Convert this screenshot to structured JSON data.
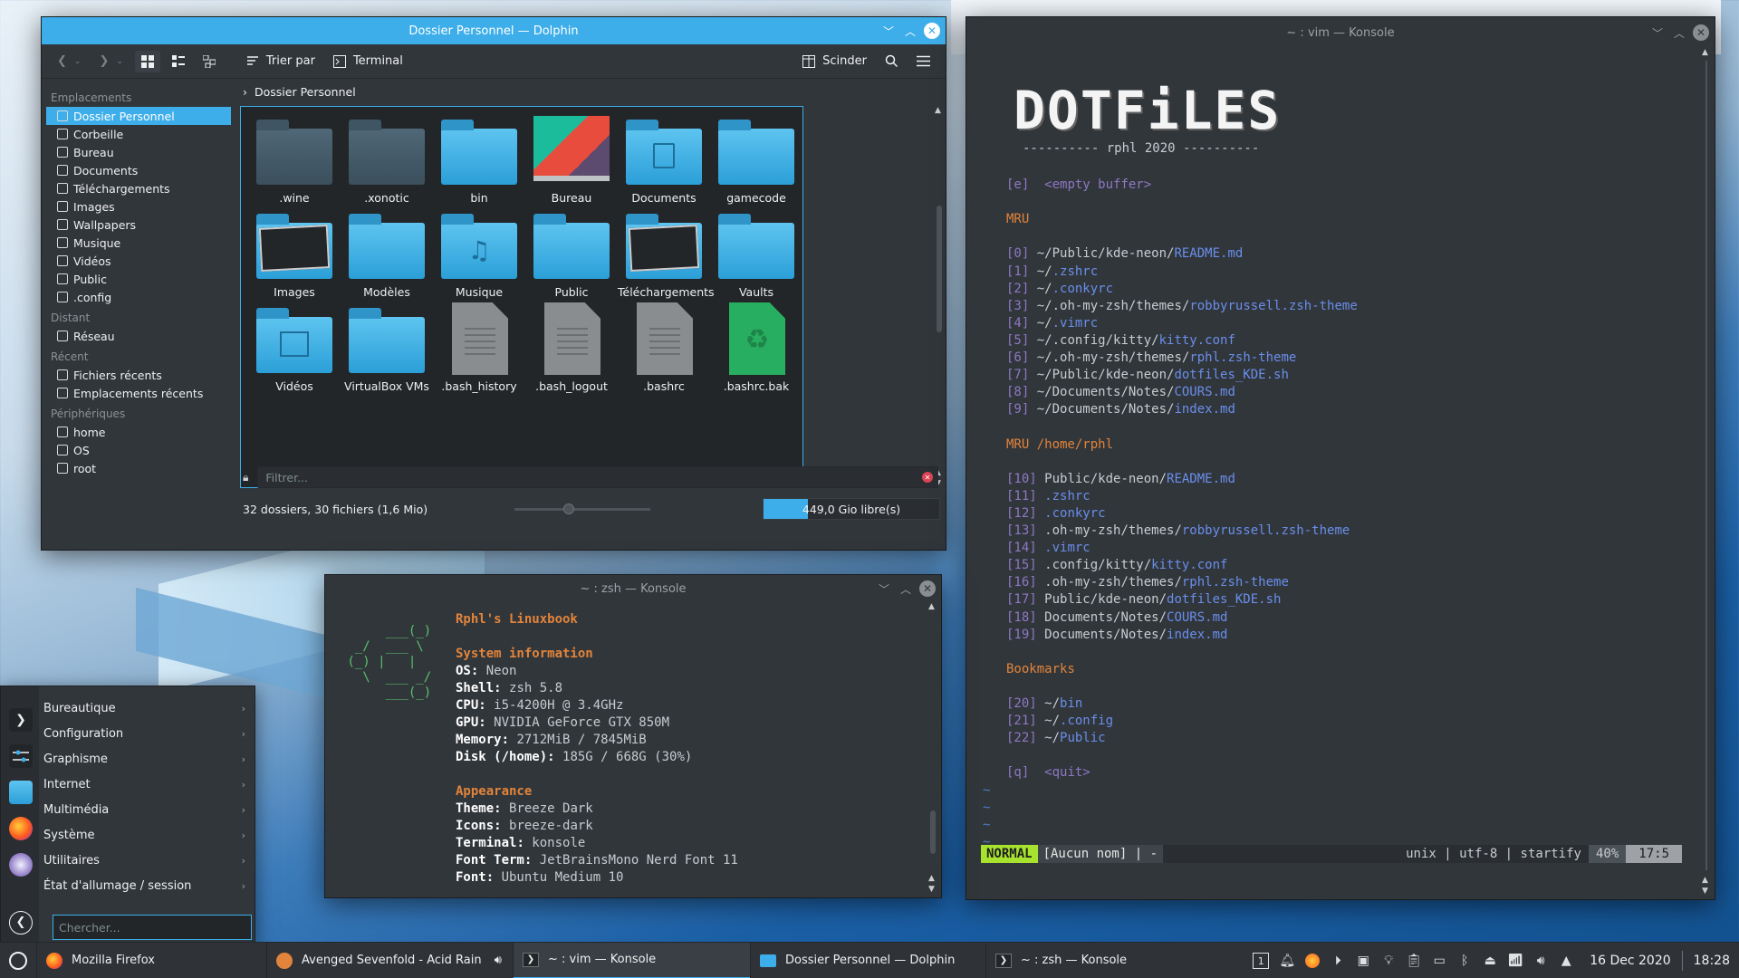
{
  "dolphin": {
    "title": "Dossier Personnel — Dolphin",
    "toolbar": {
      "sort": "Trier par",
      "terminal": "Terminal",
      "split": "Scinder"
    },
    "sidebar": [
      {
        "type": "head",
        "label": "Emplacements"
      },
      {
        "type": "item",
        "label": "Dossier Personnel",
        "selected": true,
        "icon": "home-icon"
      },
      {
        "type": "item",
        "label": "Corbeille",
        "icon": "trash-icon"
      },
      {
        "type": "item",
        "label": "Bureau",
        "icon": "desktop-icon"
      },
      {
        "type": "item",
        "label": "Documents",
        "icon": "documents-icon"
      },
      {
        "type": "item",
        "label": "Téléchargements",
        "icon": "downloads-icon"
      },
      {
        "type": "item",
        "label": "Images",
        "icon": "images-icon"
      },
      {
        "type": "item",
        "label": "Wallpapers",
        "icon": "folder-icon"
      },
      {
        "type": "item",
        "label": "Musique",
        "icon": "music-icon"
      },
      {
        "type": "item",
        "label": "Vidéos",
        "icon": "videos-icon"
      },
      {
        "type": "item",
        "label": "Public",
        "icon": "folder-icon"
      },
      {
        "type": "item",
        "label": ".config",
        "icon": "folder-icon"
      },
      {
        "type": "head",
        "label": "Distant"
      },
      {
        "type": "item",
        "label": "Réseau",
        "icon": "network-icon"
      },
      {
        "type": "head",
        "label": "Récent"
      },
      {
        "type": "item",
        "label": "Fichiers récents",
        "icon": "recent-files-icon"
      },
      {
        "type": "item",
        "label": "Emplacements récents",
        "icon": "recent-places-icon"
      },
      {
        "type": "head",
        "label": "Périphériques"
      },
      {
        "type": "item",
        "label": "home",
        "icon": "drive-icon"
      },
      {
        "type": "item",
        "label": "OS",
        "icon": "drive-icon"
      },
      {
        "type": "item",
        "label": "root",
        "icon": "drive-icon"
      }
    ],
    "breadcrumb": "Dossier Personnel",
    "files": [
      {
        "name": ".wine",
        "kind": "folder-dark"
      },
      {
        "name": ".xonotic",
        "kind": "folder-dark"
      },
      {
        "name": "bin",
        "kind": "folder"
      },
      {
        "name": "Bureau",
        "kind": "desktop"
      },
      {
        "name": "Documents",
        "kind": "folder-doc"
      },
      {
        "name": "gamecode",
        "kind": "folder"
      },
      {
        "name": "Images",
        "kind": "folder-img"
      },
      {
        "name": "Modèles",
        "kind": "folder"
      },
      {
        "name": "Musique",
        "kind": "folder-music"
      },
      {
        "name": "Public",
        "kind": "folder"
      },
      {
        "name": "Téléchargements",
        "kind": "folder-img"
      },
      {
        "name": "Vaults",
        "kind": "folder"
      },
      {
        "name": "Vidéos",
        "kind": "folder-video"
      },
      {
        "name": "VirtualBox VMs",
        "kind": "folder"
      },
      {
        "name": ".bash_history",
        "kind": "doc"
      },
      {
        "name": ".bash_logout",
        "kind": "doc"
      },
      {
        "name": ".bashrc",
        "kind": "doc"
      },
      {
        "name": ".bashrc.bak",
        "kind": "recycle"
      }
    ],
    "filter_placeholder": "Filtrer...",
    "status": "32 dossiers, 30 fichiers (1,6 Mio)",
    "free_space": "449,0 Gio libre(s)",
    "free_used_fraction": 0.25
  },
  "vim": {
    "title": "~ : vim — Konsole",
    "banner": "DOTFiLES",
    "subtitle": "---------- rphl 2020 ----------",
    "empty_key": "[e]",
    "empty_label": "<empty buffer>",
    "mru_head": "MRU",
    "mru": [
      {
        "n": "[0]",
        "dir": "~/Public/kde-neon/",
        "file": "README.md"
      },
      {
        "n": "[1]",
        "dir": "~/",
        "file": ".zshrc"
      },
      {
        "n": "[2]",
        "dir": "~/",
        "file": ".conkyrc"
      },
      {
        "n": "[3]",
        "dir": "~/.oh-my-zsh/themes/",
        "file": "robbyrussell.zsh-theme"
      },
      {
        "n": "[4]",
        "dir": "~/",
        "file": ".vimrc"
      },
      {
        "n": "[5]",
        "dir": "~/.config/kitty/",
        "file": "kitty.conf"
      },
      {
        "n": "[6]",
        "dir": "~/.oh-my-zsh/themes/",
        "file": "rphl.zsh-theme"
      },
      {
        "n": "[7]",
        "dir": "~/Public/kde-neon/",
        "file": "dotfiles_KDE.sh"
      },
      {
        "n": "[8]",
        "dir": "~/Documents/Notes/",
        "file": "COURS.md"
      },
      {
        "n": "[9]",
        "dir": "~/Documents/Notes/",
        "file": "index.md"
      }
    ],
    "mru2_head": "MRU /home/rphl",
    "mru2": [
      {
        "n": "[10]",
        "dir": "Public/kde-neon/",
        "file": "README.md"
      },
      {
        "n": "[11]",
        "dir": "",
        "file": ".zshrc"
      },
      {
        "n": "[12]",
        "dir": "",
        "file": ".conkyrc"
      },
      {
        "n": "[13]",
        "dir": ".oh-my-zsh/themes/",
        "file": "robbyrussell.zsh-theme"
      },
      {
        "n": "[14]",
        "dir": "",
        "file": ".vimrc"
      },
      {
        "n": "[15]",
        "dir": ".config/kitty/",
        "file": "kitty.conf"
      },
      {
        "n": "[16]",
        "dir": ".oh-my-zsh/themes/",
        "file": "rphl.zsh-theme"
      },
      {
        "n": "[17]",
        "dir": "Public/kde-neon/",
        "file": "dotfiles_KDE.sh"
      },
      {
        "n": "[18]",
        "dir": "Documents/Notes/",
        "file": "COURS.md"
      },
      {
        "n": "[19]",
        "dir": "Documents/Notes/",
        "file": "index.md"
      }
    ],
    "bm_head": "Bookmarks",
    "bookmarks": [
      {
        "n": "[20]",
        "dir": "~/",
        "file": "bin"
      },
      {
        "n": "[21]",
        "dir": "~/",
        "file": ".config"
      },
      {
        "n": "[22]",
        "dir": "~/",
        "file": "Public"
      }
    ],
    "quit_key": "[q]",
    "quit_label": "<quit>",
    "status": {
      "mode": "NORMAL",
      "name": "[Aucun nom] | -",
      "info": "unix | utf-8 | startify",
      "percent": "40%",
      "pos": "17:5"
    }
  },
  "zsh": {
    "title": "~ : zsh — Konsole",
    "host": "Rphl's Linuxbook",
    "sys_head": "System information",
    "sys": [
      {
        "k": "OS",
        "v": "Neon"
      },
      {
        "k": "Shell",
        "v": "zsh 5.8"
      },
      {
        "k": "CPU",
        "v": "i5-4200H @ 3.4GHz"
      },
      {
        "k": "GPU",
        "v": "NVIDIA GeForce GTX 850M"
      },
      {
        "k": "Memory",
        "v": "2712MiB / 7845MiB"
      },
      {
        "k": "Disk (/home)",
        "v": "185G / 668G (30%)"
      }
    ],
    "app_head": "Appearance",
    "app": [
      {
        "k": "Theme",
        "v": "Breeze Dark"
      },
      {
        "k": "Icons",
        "v": "breeze-dark"
      },
      {
        "k": "Terminal",
        "v": "konsole"
      },
      {
        "k": "Font Term",
        "v": "JetBrainsMono Nerd Font 11"
      },
      {
        "k": "Font",
        "v": "Ubuntu Medium 10"
      }
    ]
  },
  "menu": {
    "items": [
      "Bureautique",
      "Configuration",
      "Graphisme",
      "Internet",
      "Multimédia",
      "Système",
      "Utilitaires",
      "État d'allumage / session"
    ],
    "search_placeholder": "Chercher..."
  },
  "taskbar": {
    "tasks": [
      {
        "label": "Mozilla Firefox",
        "icon": "firefox-icon"
      },
      {
        "label": "Avenged Sevenfold - Acid Rain",
        "icon": "music-player-icon"
      },
      {
        "label": "~ : vim — Konsole",
        "icon": "konsole-icon"
      },
      {
        "label": "Dossier Personnel — Dolphin",
        "icon": "dolphin-icon"
      },
      {
        "label": "~ : zsh — Konsole",
        "icon": "konsole-icon"
      }
    ],
    "desktop_num": "1",
    "date": "16 Dec 2020",
    "time": "18:28"
  },
  "colors": {
    "accent": "#3daee9",
    "window": "#31363b",
    "view": "#232629",
    "orange": "#e2843b",
    "purple": "#8e78c4",
    "blue_file": "#6a8eea",
    "vim_green": "#a6e22e"
  }
}
